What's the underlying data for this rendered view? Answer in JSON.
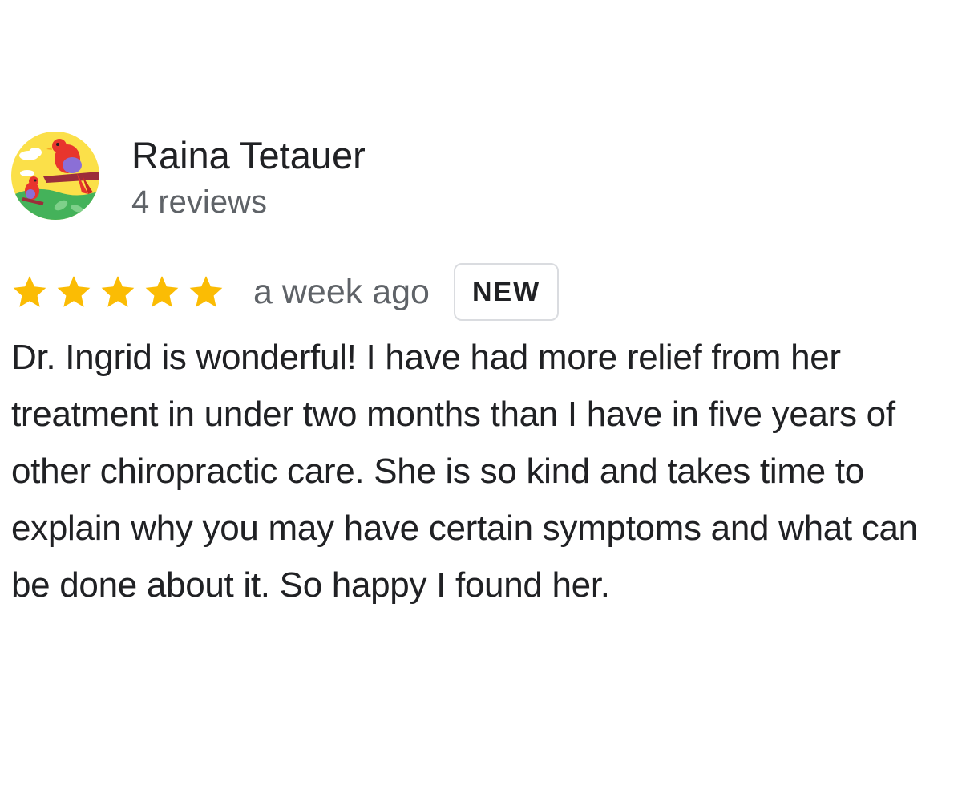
{
  "review": {
    "author_name": "Raina Tetauer",
    "author_meta": "4 reviews",
    "rating": 5,
    "rating_max": 5,
    "date": "a week ago",
    "badge": "NEW",
    "text": "Dr. Ingrid is wonderful! I have had more relief from her treatment in under two months than I have in five years of other chiropractic care. She is so kind and takes time to explain why you may have certain symptoms and what can be done about it. So happy I found her."
  },
  "icons": {
    "avatar": "bird-illustration-avatar",
    "star": "star-icon"
  },
  "colors": {
    "star": "#fbbc04",
    "name": "#202124",
    "secondary_text": "#5f6368",
    "badge_border": "#dadce0"
  }
}
